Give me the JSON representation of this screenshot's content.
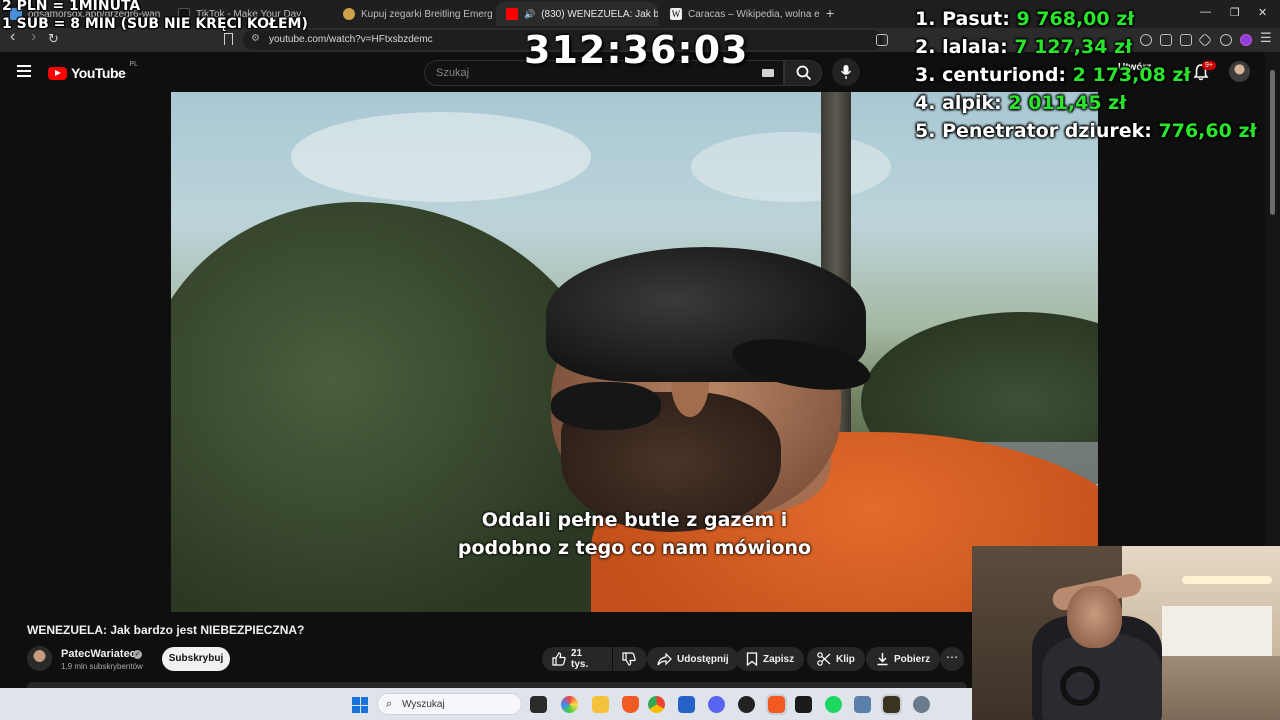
{
  "browser": {
    "tabs": [
      {
        "label": "odsamorsox.app/grzegr6-wan",
        "favicon_color": "#4a90d9",
        "active": false
      },
      {
        "label": "TikTok - Make Your Day",
        "favicon_color": "#111111",
        "active": false
      },
      {
        "label": "Kupuj zegarki Breitling Emergency II",
        "favicon_color": "#cfa24a",
        "active": false
      },
      {
        "label": "(830) WENEZUELA: Jak bardzo",
        "favicon_color": "#ff0000",
        "active": true
      },
      {
        "label": "Caracas – Wikipedia, wolna encyklop",
        "favicon_color": "#eeeeee",
        "active": false
      }
    ],
    "new_tab": "+",
    "window_controls": {
      "minimize": "—",
      "restore": "❐",
      "close": "✕"
    },
    "nav": {
      "back": "‹",
      "forward": "›",
      "reload": "↻"
    },
    "url": "youtube.com/watch?v=HFtxsbzdemc"
  },
  "youtube": {
    "logo_text": "YouTube",
    "logo_country": "PL",
    "search_placeholder": "Szukaj",
    "create_label": "Utwórz",
    "notification_count": "9+",
    "video": {
      "subtitle_line1": "Oddali pełne butle z gazem i",
      "subtitle_line2": "podobno z tego co nam mówiono"
    },
    "title": "WENEZUELA: Jak bardzo jest NIEBEZPIECZNA?",
    "channel": {
      "name": "PatecWariatec",
      "subscribers": "1,9 mln subskrybentów",
      "subscribe_label": "Subskrybuj",
      "verified": "✓"
    },
    "actions": {
      "likes": "21 tys.",
      "share": "Udostępnij",
      "save": "Zapisz",
      "clip": "Klip",
      "download": "Pobierz",
      "more": "⋯"
    }
  },
  "overlay": {
    "rate_line1": "2 PLN = 1MINUTA",
    "rate_line2": "1 SUB = 8 MIN (SUB NIE KRĘCI KOŁEM)",
    "timer": "312:36:03",
    "leaderboard": [
      {
        "rank": "1.",
        "name": "Pasut:",
        "amount": "9 768,00 zł"
      },
      {
        "rank": "2.",
        "name": "lalala:",
        "amount": "7 127,34 zł"
      },
      {
        "rank": "3.",
        "name": "centuriond:",
        "amount": "2 173,08 zł"
      },
      {
        "rank": "4.",
        "name": "alpik:",
        "amount": "2 011,45 zł"
      },
      {
        "rank": "5.",
        "name": "Penetrator dziurek:",
        "amount": "776,60 zł"
      }
    ],
    "amount_color": "#29e52b"
  },
  "taskbar": {
    "search_placeholder": "Wyszukaj"
  }
}
